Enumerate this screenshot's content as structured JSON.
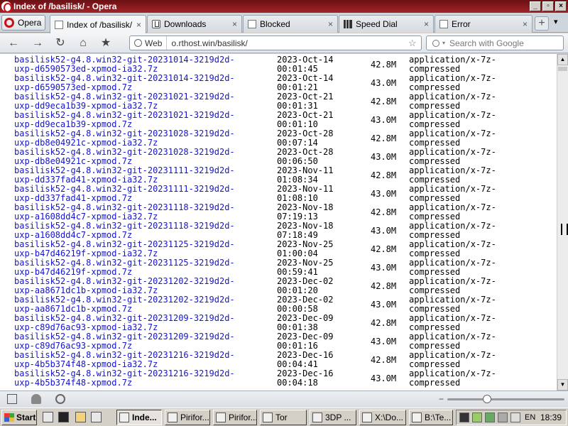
{
  "window": {
    "title": "Index of /basilisk/ - Opera",
    "controls": [
      "_",
      "▫",
      "×"
    ]
  },
  "tabs": {
    "menu_label": "Opera",
    "items": [
      {
        "label": "Index of /basilisk/",
        "icon": "page-icon",
        "active": true
      },
      {
        "label": "Downloads",
        "icon": "downloads-icon",
        "active": false
      },
      {
        "label": "Blocked",
        "icon": "page-icon",
        "active": false
      },
      {
        "label": "Speed Dial",
        "icon": "speed-dial-icon",
        "active": false
      },
      {
        "label": "Error",
        "icon": "page-icon",
        "active": false
      }
    ],
    "close_glyph": "×",
    "new_tab_glyph": "+",
    "tab_list_glyph": "▾"
  },
  "toolbar": {
    "back": "←",
    "forward": "→",
    "reload": "↻",
    "home": "⌂",
    "bookmarks": "★",
    "web_badge": "Web",
    "url": "o.rthost.win/basilisk/",
    "star": "☆",
    "search_placeholder": "Search with Google"
  },
  "listing": [
    {
      "name": [
        "basilisk52-g4.8.win32-git-20231014-3219d2d-",
        "uxp-d6590573ed-xpmod-ia32.7z"
      ],
      "date": [
        "2023-Oct-14",
        "00:01:45"
      ],
      "size": "42.8M",
      "type": [
        "application/x-7z-",
        "compressed"
      ]
    },
    {
      "name": [
        "basilisk52-g4.8.win32-git-20231014-3219d2d-",
        "uxp-d6590573ed-xpmod.7z"
      ],
      "date": [
        "2023-Oct-14",
        "00:01:21"
      ],
      "size": "43.0M",
      "type": [
        "application/x-7z-",
        "compressed"
      ]
    },
    {
      "name": [
        "basilisk52-g4.8.win32-git-20231021-3219d2d-",
        "uxp-dd9eca1b39-xpmod-ia32.7z"
      ],
      "date": [
        "2023-Oct-21",
        "00:01:31"
      ],
      "size": "42.8M",
      "type": [
        "application/x-7z-",
        "compressed"
      ]
    },
    {
      "name": [
        "basilisk52-g4.8.win32-git-20231021-3219d2d-",
        "uxp-dd9eca1b39-xpmod.7z"
      ],
      "date": [
        "2023-Oct-21",
        "00:01:10"
      ],
      "size": "43.0M",
      "type": [
        "application/x-7z-",
        "compressed"
      ]
    },
    {
      "name": [
        "basilisk52-g4.8.win32-git-20231028-3219d2d-",
        "uxp-db8e04921c-xpmod-ia32.7z"
      ],
      "date": [
        "2023-Oct-28",
        "00:07:14"
      ],
      "size": "42.8M",
      "type": [
        "application/x-7z-",
        "compressed"
      ]
    },
    {
      "name": [
        "basilisk52-g4.8.win32-git-20231028-3219d2d-",
        "uxp-db8e04921c-xpmod.7z"
      ],
      "date": [
        "2023-Oct-28",
        "00:06:50"
      ],
      "size": "43.0M",
      "type": [
        "application/x-7z-",
        "compressed"
      ]
    },
    {
      "name": [
        "basilisk52-g4.8.win32-git-20231111-3219d2d-",
        "uxp-dd337fad41-xpmod-ia32.7z"
      ],
      "date": [
        "2023-Nov-11",
        "01:08:34"
      ],
      "size": "42.8M",
      "type": [
        "application/x-7z-",
        "compressed"
      ]
    },
    {
      "name": [
        "basilisk52-g4.8.win32-git-20231111-3219d2d-",
        "uxp-dd337fad41-xpmod.7z"
      ],
      "date": [
        "2023-Nov-11",
        "01:08:10"
      ],
      "size": "43.0M",
      "type": [
        "application/x-7z-",
        "compressed"
      ]
    },
    {
      "name": [
        "basilisk52-g4.8.win32-git-20231118-3219d2d-",
        "uxp-a1608dd4c7-xpmod-ia32.7z"
      ],
      "date": [
        "2023-Nov-18",
        "07:19:13"
      ],
      "size": "42.8M",
      "type": [
        "application/x-7z-",
        "compressed"
      ]
    },
    {
      "name": [
        "basilisk52-g4.8.win32-git-20231118-3219d2d-",
        "uxp-a1608dd4c7-xpmod.7z"
      ],
      "date": [
        "2023-Nov-18",
        "07:18:49"
      ],
      "size": "43.0M",
      "type": [
        "application/x-7z-",
        "compressed"
      ]
    },
    {
      "name": [
        "basilisk52-g4.8.win32-git-20231125-3219d2d-",
        "uxp-b47d46219f-xpmod-ia32.7z"
      ],
      "date": [
        "2023-Nov-25",
        "01:00:04"
      ],
      "size": "42.8M",
      "type": [
        "application/x-7z-",
        "compressed"
      ]
    },
    {
      "name": [
        "basilisk52-g4.8.win32-git-20231125-3219d2d-",
        "uxp-b47d46219f-xpmod.7z"
      ],
      "date": [
        "2023-Nov-25",
        "00:59:41"
      ],
      "size": "43.0M",
      "type": [
        "application/x-7z-",
        "compressed"
      ]
    },
    {
      "name": [
        "basilisk52-g4.8.win32-git-20231202-3219d2d-",
        "uxp-aa8671dc1b-xpmod-ia32.7z"
      ],
      "date": [
        "2023-Dec-02",
        "00:01:20"
      ],
      "size": "42.8M",
      "type": [
        "application/x-7z-",
        "compressed"
      ]
    },
    {
      "name": [
        "basilisk52-g4.8.win32-git-20231202-3219d2d-",
        "uxp-aa8671dc1b-xpmod.7z"
      ],
      "date": [
        "2023-Dec-02",
        "00:00:58"
      ],
      "size": "43.0M",
      "type": [
        "application/x-7z-",
        "compressed"
      ]
    },
    {
      "name": [
        "basilisk52-g4.8.win32-git-20231209-3219d2d-",
        "uxp-c89d76ac93-xpmod-ia32.7z"
      ],
      "date": [
        "2023-Dec-09",
        "00:01:38"
      ],
      "size": "42.8M",
      "type": [
        "application/x-7z-",
        "compressed"
      ]
    },
    {
      "name": [
        "basilisk52-g4.8.win32-git-20231209-3219d2d-",
        "uxp-c89d76ac93-xpmod.7z"
      ],
      "date": [
        "2023-Dec-09",
        "00:01:16"
      ],
      "size": "43.0M",
      "type": [
        "application/x-7z-",
        "compressed"
      ]
    },
    {
      "name": [
        "basilisk52-g4.8.win32-git-20231216-3219d2d-",
        "uxp-4b5b374f48-xpmod-ia32.7z"
      ],
      "date": [
        "2023-Dec-16",
        "00:04:41"
      ],
      "size": "42.8M",
      "type": [
        "application/x-7z-",
        "compressed"
      ]
    },
    {
      "name": [
        "basilisk52-g4.8.win32-git-20231216-3219d2d-",
        "uxp-4b5b374f48-xpmod.7z"
      ],
      "date": [
        "2023-Dec-16",
        "00:04:18"
      ],
      "size": "43.0M",
      "type": [
        "application/x-7z-",
        "compressed"
      ]
    }
  ],
  "scrollbar": {
    "up": "▲",
    "down": "▼"
  },
  "statusbar": {
    "zoom_minus": "−"
  },
  "taskbar": {
    "start_label": "Start",
    "tasks": [
      {
        "label": "Inde...",
        "active": true,
        "icon": "opera-icon"
      },
      {
        "label": "Pirifor...",
        "active": false,
        "icon": "app-icon"
      },
      {
        "label": "Pirifor...",
        "active": false,
        "icon": "app-icon"
      },
      {
        "label": "Tor",
        "active": false,
        "icon": "console-icon"
      },
      {
        "label": "3DP ...",
        "active": false,
        "icon": "app-icon"
      },
      {
        "label": "X:\\Do...",
        "active": false,
        "icon": "folder-icon"
      },
      {
        "label": "B:\\Te...",
        "active": false,
        "icon": "folder-icon"
      }
    ],
    "language": "EN",
    "clock": "18:39"
  },
  "colors": {
    "link": "#1515cc",
    "titlebar": "#a32226"
  }
}
